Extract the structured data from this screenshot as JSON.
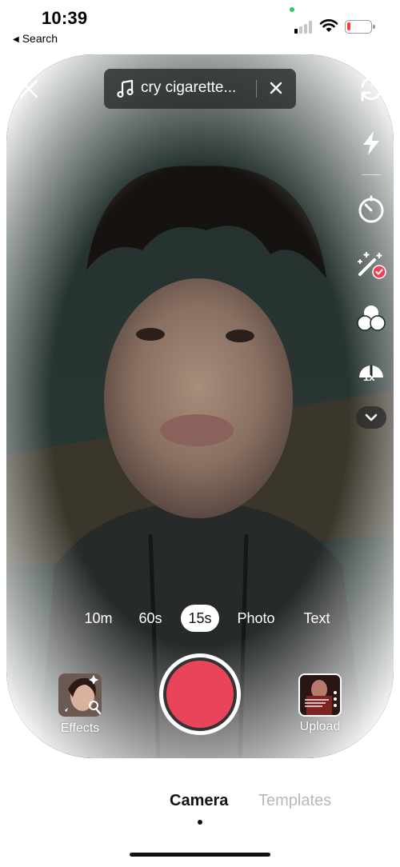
{
  "status_bar": {
    "time": "10:39",
    "back_app": "Search",
    "signal_bars_active": 1,
    "signal_bars_total": 4,
    "battery_level": 0.15,
    "battery_color": "#ff3b30",
    "privacy_dot_color": "#34c759"
  },
  "camera": {
    "close_icon": "close-icon",
    "sound": {
      "icon": "music-note-icon",
      "title": "cry cigarette...",
      "remove_icon": "close-icon"
    },
    "side_tools": [
      {
        "name": "flip-camera",
        "icon": "flip-camera-icon"
      },
      {
        "name": "flash",
        "icon": "flash-icon"
      },
      {
        "name": "timer",
        "icon": "timer-icon"
      },
      {
        "name": "beauty",
        "icon": "magic-wand-icon"
      },
      {
        "name": "filters",
        "icon": "filters-icon"
      },
      {
        "name": "speed",
        "icon": "speed-icon",
        "label": "1x"
      },
      {
        "name": "more",
        "icon": "chevron-down-icon"
      }
    ],
    "accent_color": "#e9445a",
    "modes": [
      {
        "label": "10m",
        "active": false
      },
      {
        "label": "60s",
        "active": false
      },
      {
        "label": "15s",
        "active": true
      },
      {
        "label": "Photo",
        "active": false
      },
      {
        "label": "Text",
        "active": false
      }
    ],
    "effects_label": "Effects",
    "upload_label": "Upload"
  },
  "bottom_tabs": [
    {
      "label": "Camera",
      "active": true
    },
    {
      "label": "Templates",
      "active": false
    }
  ]
}
